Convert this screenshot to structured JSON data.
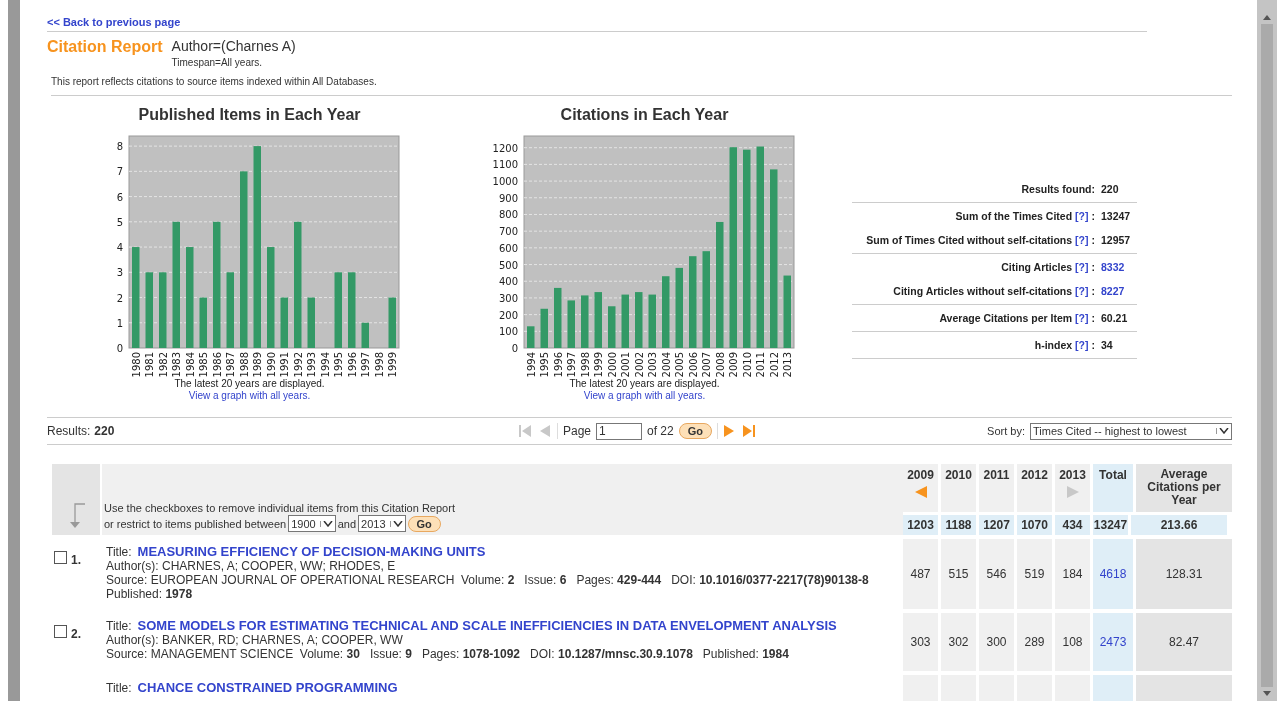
{
  "back_link": "<< Back to previous page",
  "header": {
    "title": "Citation Report",
    "query": "Author=(Charnes A)",
    "timespan": "Timespan=All years.",
    "note": "This report reflects citations to source items indexed within All Databases."
  },
  "charts": [
    {
      "chart_data": {
        "type": "bar",
        "title": "Published Items in Each Year",
        "categories": [
          "1980",
          "1981",
          "1982",
          "1983",
          "1984",
          "1985",
          "1986",
          "1987",
          "1988",
          "1989",
          "1990",
          "1991",
          "1992",
          "1993",
          "1994",
          "1995",
          "1996",
          "1997",
          "1998",
          "1999"
        ],
        "values": [
          4,
          3,
          3,
          5,
          4,
          2,
          5,
          3,
          7,
          8,
          4,
          2,
          5,
          2,
          0,
          3,
          3,
          1,
          0,
          2
        ],
        "ylim": [
          0,
          8.4
        ],
        "grid": true,
        "yticks": [
          0,
          1,
          2,
          3,
          4,
          5,
          6,
          7,
          8
        ]
      },
      "note": "The latest 20 years are displayed.",
      "link": "View a graph with all years."
    },
    {
      "chart_data": {
        "type": "bar",
        "title": "Citations in Each Year",
        "categories": [
          "1994",
          "1995",
          "1996",
          "1997",
          "1998",
          "1999",
          "2000",
          "2001",
          "2002",
          "2003",
          "2004",
          "2005",
          "2006",
          "2007",
          "2008",
          "2009",
          "2010",
          "2011",
          "2012",
          "2013"
        ],
        "values": [
          130,
          235,
          360,
          285,
          315,
          335,
          250,
          320,
          335,
          320,
          430,
          480,
          550,
          580,
          755,
          1203,
          1188,
          1207,
          1070,
          434
        ],
        "ylim": [
          0,
          1270
        ],
        "grid": true,
        "yticks": [
          0,
          100,
          200,
          300,
          400,
          500,
          600,
          700,
          800,
          900,
          1000,
          1100,
          1200
        ]
      },
      "note": "The latest 20 years are displayed.",
      "link": "View a graph with all years."
    }
  ],
  "stats": [
    [
      {
        "label": "Results found:",
        "value": "220",
        "link": false
      }
    ],
    [
      {
        "label": "Sum of the Times Cited",
        "help": "[?]",
        "colon": ":",
        "value": "13247",
        "link": false
      },
      {
        "label": "Sum of Times Cited without self-citations",
        "help": "[?]",
        "colon": ":",
        "value": "12957",
        "link": false
      }
    ],
    [
      {
        "label": "Citing Articles",
        "help": "[?]",
        "colon": ":",
        "value": "8332",
        "link": true
      },
      {
        "label": "Citing Articles without self-citations",
        "help": "[?]",
        "colon": ":",
        "value": "8227",
        "link": true
      }
    ],
    [
      {
        "label": "Average Citations per Item",
        "help": "[?]",
        "colon": ":",
        "value": "60.21",
        "link": false
      }
    ],
    [
      {
        "label": "h-index",
        "help": "[?]",
        "colon": ":",
        "value": "34",
        "link": false
      }
    ]
  ],
  "results": {
    "label": "Results:",
    "count": "220"
  },
  "pager": {
    "nav": [
      {
        "kind": "first",
        "disabled": true
      },
      {
        "kind": "prev",
        "disabled": true
      },
      {
        "kind": "next",
        "disabled": false
      },
      {
        "kind": "last",
        "disabled": false
      }
    ],
    "page_label": "Page",
    "page": "1",
    "of": "of 22",
    "go": "Go"
  },
  "sort": {
    "label": "Sort by:",
    "value": "Times Cited -- highest to lowest"
  },
  "table": {
    "instructions": [
      "Use the checkboxes to remove individual items from this Citation Report",
      "or restrict to items published between"
    ],
    "from_year": "1900",
    "and": "and",
    "to_year": "2013",
    "go": "Go",
    "years": [
      {
        "label": "2009",
        "kind": "prev",
        "disabled": false
      },
      {
        "label": "2010",
        "kind": "plain"
      },
      {
        "label": "2011",
        "kind": "plain"
      },
      {
        "label": "2012",
        "kind": "plain"
      },
      {
        "label": "2013",
        "kind": "next",
        "disabled": true
      }
    ],
    "total_label": "Total",
    "average_label": "Average Citations per Year",
    "totals": [
      "1203",
      "1188",
      "1207",
      "1070",
      "434"
    ],
    "total": "13247",
    "average": "213.66",
    "rows": [
      {
        "number": "1.",
        "checked": false,
        "title_label": "Title:",
        "title": "MEASURING EFFICIENCY OF DECISION-MAKING UNITS",
        "authors": "Author(s): CHARNES, A; COOPER, WW; RHODES, E",
        "source": "Source: EUROPEAN JOURNAL OF OPERATIONAL RESEARCH  Volume: **2**   Issue: **6**   Pages: **429-444**   DOI: **10.1016/0377-2217(78)90138-8**   Published: **1978**",
        "counts": [
          "487",
          "515",
          "546",
          "519",
          "184"
        ],
        "total": "4618",
        "average": "128.31"
      },
      {
        "number": "2.",
        "checked": false,
        "title_label": "Title:",
        "title": "SOME MODELS FOR ESTIMATING TECHNICAL AND SCALE INEFFICIENCIES IN DATA ENVELOPMENT ANALYSIS",
        "authors": "Author(s): BANKER, RD; CHARNES, A; COOPER, WW",
        "source": "Source: MANAGEMENT SCIENCE  Volume: **30**   Issue: **9**   Pages: **1078-1092**   DOI: **10.1287/mnsc.30.9.1078**   Published: **1984**",
        "counts": [
          "303",
          "302",
          "300",
          "289",
          "108"
        ],
        "total": "2473",
        "average": "82.47"
      },
      {
        "title_label": "Title:",
        "title": "CHANCE CONSTRAINED PROGRAMMING"
      }
    ]
  }
}
